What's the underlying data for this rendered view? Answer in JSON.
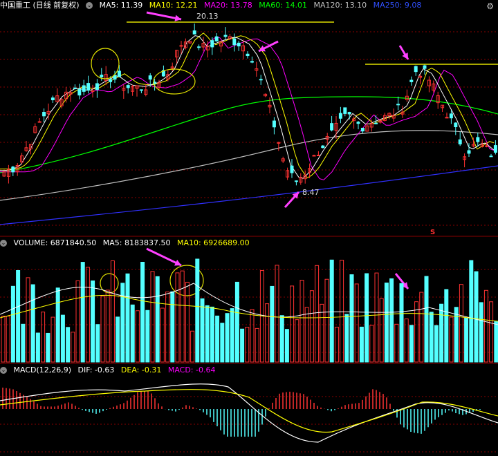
{
  "price_header": {
    "title": "中国重工 (日线 前复权)",
    "ma5": "MA5: 11.39",
    "ma10": "MA10: 12.21",
    "ma20": "MA20: 13.78",
    "ma60": "MA60: 14.01",
    "ma120": "MA120: 13.10",
    "ma250": "MA250: 9.08"
  },
  "volume_header": {
    "title": "VOLUME: 6871840.50",
    "ma5": "MA5: 8183837.50",
    "ma10": "MA10: 6926689.00"
  },
  "macd_header": {
    "title": "MACD(12,26,9)",
    "dif": "DIF: -0.63",
    "dea": "DEA: -0.31",
    "macd": "MACD: -0.64"
  },
  "annotations": {
    "high_label": "20.13",
    "low_label": "8.47",
    "marker": "S"
  },
  "colors": {
    "up": "#ff3232",
    "down": "#54ffff",
    "ma5": "#ffffff",
    "ma10": "#ffff00",
    "ma20": "#ff00ff",
    "ma60": "#00ff00",
    "ma120": "#c0c0c0",
    "ma250": "#3030ff",
    "arrow": "#ff40ff",
    "circle": "#e0e000"
  },
  "icons": [
    "circle-icon",
    "gear-icon",
    "arrow-icon"
  ]
}
